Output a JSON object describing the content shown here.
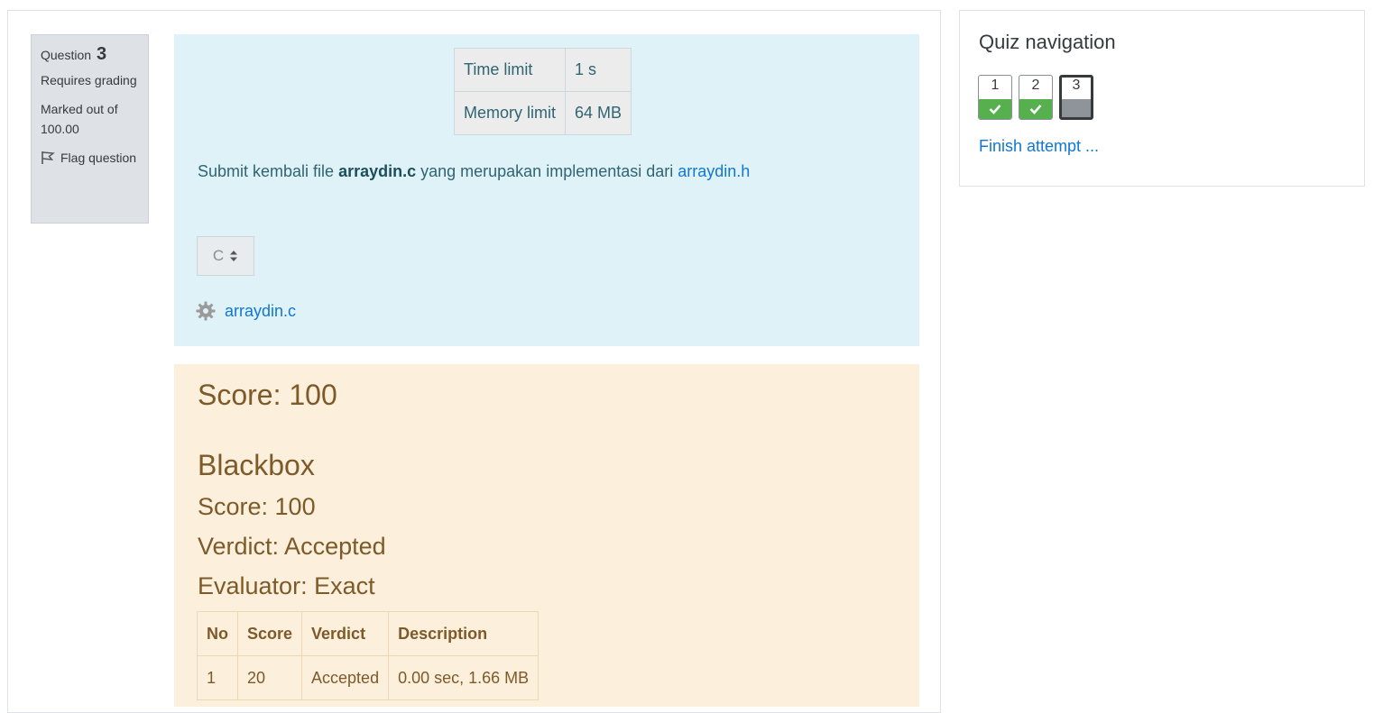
{
  "question": {
    "label": "Question",
    "number": "3",
    "status": "Requires grading",
    "marked_out_of": "Marked out of 100.00",
    "flag_label": "Flag question"
  },
  "formulation": {
    "limits": [
      {
        "name": "Time limit",
        "value": "1 s"
      },
      {
        "name": "Memory limit",
        "value": "64 MB"
      }
    ],
    "prompt_prefix": "Submit kembali file ",
    "prompt_bold": "arraydin.c",
    "prompt_middle": " yang merupakan implementasi dari ",
    "prompt_link": "arraydin.h",
    "language_selected": "C",
    "file_link": "arraydin.c",
    "file_icon": "gear-icon"
  },
  "feedback": {
    "score_heading": "Score: 100",
    "section_title": "Blackbox",
    "score_line": "Score: 100",
    "verdict_line": "Verdict: Accepted",
    "evaluator_line": "Evaluator: Exact",
    "table": {
      "headers": [
        "No",
        "Score",
        "Verdict",
        "Description"
      ],
      "rows": [
        [
          "1",
          "20",
          "Accepted",
          "0.00 sec, 1.66 MB"
        ]
      ]
    }
  },
  "navigation": {
    "title": "Quiz navigation",
    "buttons": [
      {
        "label": "1",
        "state": "answered"
      },
      {
        "label": "2",
        "state": "answered"
      },
      {
        "label": "3",
        "state": "current"
      }
    ],
    "finish_link": "Finish attempt ..."
  },
  "colors": {
    "link": "#1177d1",
    "info_bg": "#def2f8",
    "feedback_bg": "#fcefdc",
    "answered_green": "#56b04e",
    "current_grey": "#8e9499"
  }
}
